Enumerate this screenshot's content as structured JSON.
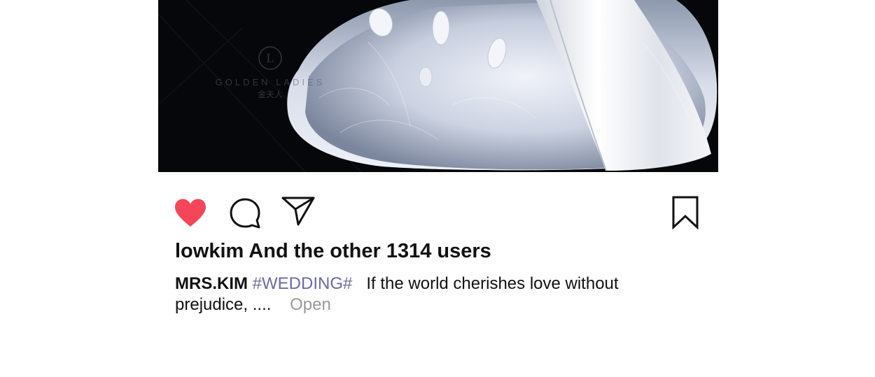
{
  "photo": {
    "watermark_brand": "GOLDEN LADIES",
    "watermark_cn": "金夫人"
  },
  "actions": {
    "like_icon": "heart-filled-icon",
    "comment_icon": "speech-bubble-icon",
    "share_icon": "paper-plane-icon",
    "save_icon": "bookmark-icon",
    "like_color": "#f44559"
  },
  "likes_text": "lowkim And the other 1314 users",
  "caption": {
    "username": "MRS.KIM",
    "hashtag": "#WEDDING#",
    "text": "If the world cherishes love without prejudice, ....",
    "more_label": "Open"
  },
  "colors": {
    "hashtag": "#6a6aa6",
    "muted": "#9a9a9a",
    "text": "#111111"
  }
}
